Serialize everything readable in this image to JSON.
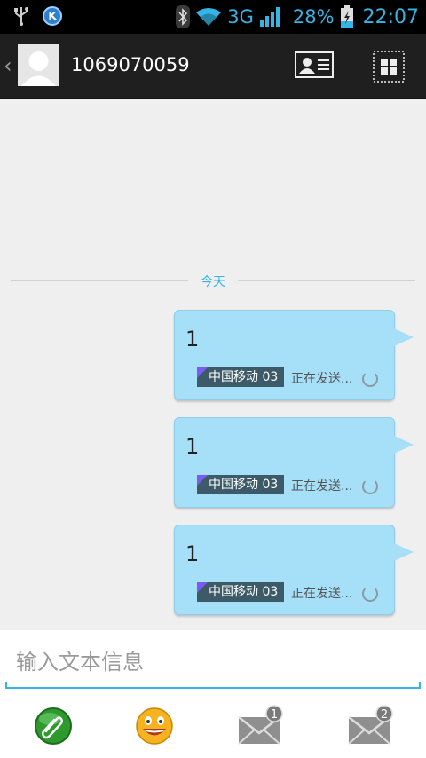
{
  "status_bar": {
    "network": "3G",
    "battery": "28%",
    "time": "22:07",
    "left_icons": [
      "usb-icon",
      "k-icon"
    ],
    "right_icons": [
      "bluetooth-icon",
      "wifi-icon",
      "signal-icon",
      "battery-charging-icon"
    ]
  },
  "action_bar": {
    "contact_number": "1069070059",
    "icons": [
      "back-icon",
      "avatar",
      "contact-card-icon",
      "grid-menu-icon"
    ]
  },
  "conversation": {
    "date_label": "今天",
    "messages": [
      {
        "text": "1",
        "sim": "中国移动 03",
        "status": "正在发送..."
      },
      {
        "text": "1",
        "sim": "中国移动 03",
        "status": "正在发送..."
      },
      {
        "text": "1",
        "sim": "中国移动 03",
        "status": "正在发送..."
      }
    ]
  },
  "composer": {
    "placeholder": "输入文本信息",
    "value": "",
    "buttons": [
      {
        "name": "attach-icon"
      },
      {
        "name": "emoji-icon"
      },
      {
        "name": "send-sim1-icon",
        "badge": "1"
      },
      {
        "name": "send-sim2-icon",
        "badge": "2"
      }
    ]
  },
  "colors": {
    "accent": "#33b5e5",
    "bubble": "#a5dff8",
    "sim_badge": "#3c5a67",
    "sim_corner": "#7b5cf0"
  }
}
